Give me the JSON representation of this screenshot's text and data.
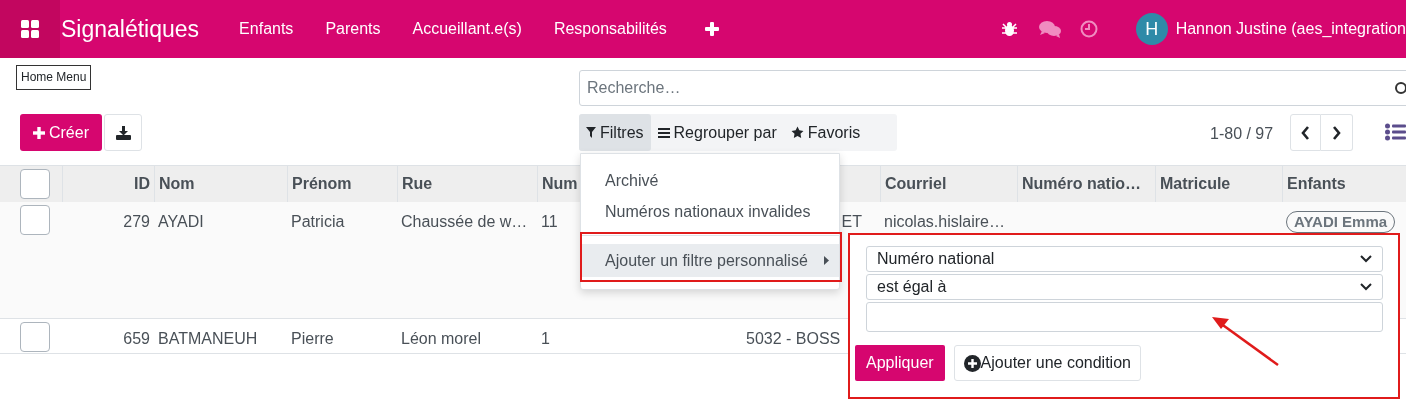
{
  "navbar": {
    "app_title": "Signalétiques",
    "menu": [
      {
        "label": "Enfants"
      },
      {
        "label": "Parents"
      },
      {
        "label": "Accueillant.e(s)"
      },
      {
        "label": "Responsabilités"
      }
    ],
    "user": {
      "initial": "H",
      "name": "Hannon Justine (aes_integration"
    }
  },
  "tooltip": "Home Menu",
  "search": {
    "placeholder": "Recherche…"
  },
  "create_button": "Créer",
  "search_tabs": [
    {
      "label": "Filtres",
      "selected": true
    },
    {
      "label": "Regrouper par",
      "selected": false
    },
    {
      "label": "Favoris",
      "selected": false
    }
  ],
  "pager": "1-80 / 97",
  "table": {
    "header_checked": false,
    "columns": [
      "ID",
      "Nom",
      "Prénom",
      "Rue",
      "Num",
      "",
      "Courriel",
      "Numéro natio…",
      "Matricule",
      "Enfants"
    ],
    "rows": [
      {
        "checked": false,
        "cells": [
          "279",
          "AYADI",
          "Patricia",
          "Chaussée de w…",
          "11",
          "ET",
          "nicolas.hislaire…"
        ],
        "tags": [
          "AYADI Emma"
        ]
      },
      {
        "checked": false,
        "cells": [
          "659",
          "BATMANEUH",
          "Pierre",
          "Léon morel",
          "1",
          "5032 - BOSS"
        ]
      }
    ]
  },
  "filter_menu": {
    "items": [
      {
        "label": "Archivé",
        "selected": false
      },
      {
        "label": "Numéros nationaux invalides",
        "selected": false
      }
    ],
    "custom": {
      "label": "Ajouter un filtre personnalisé",
      "selected": true
    },
    "field": "Numéro national",
    "operator": "est égal à",
    "apply": "Appliquer",
    "add_condition": "Ajouter une condition"
  }
}
